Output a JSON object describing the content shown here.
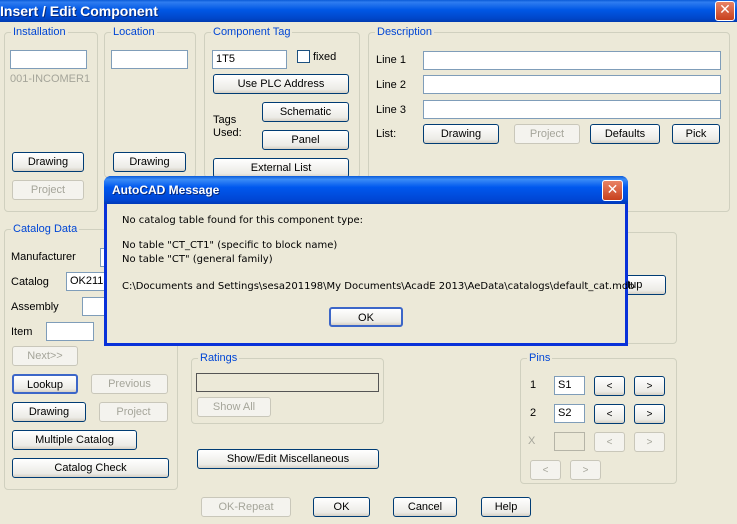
{
  "window": {
    "title": "Insert / Edit Component",
    "close_label": "✕"
  },
  "installation": {
    "legend": "Installation",
    "value": "",
    "sub_text": "001-INCOMER1",
    "drawing_label": "Drawing",
    "project_label": "Project"
  },
  "location": {
    "legend": "Location",
    "value": "",
    "drawing_label": "Drawing"
  },
  "component_tag": {
    "legend": "Component Tag",
    "value": "1T5",
    "fixed_label": "fixed",
    "use_plc_label": "Use PLC Address",
    "tags_used_label_1": "Tags",
    "tags_used_label_2": "Used:",
    "schematic_label": "Schematic",
    "panel_label": "Panel",
    "external_list_label": "External List"
  },
  "description": {
    "legend": "Description",
    "lines": [
      {
        "label": "Line 1",
        "value": ""
      },
      {
        "label": "Line 2",
        "value": ""
      },
      {
        "label": "Line 3",
        "value": ""
      }
    ],
    "list_label": "List:",
    "drawing_label": "Drawing",
    "project_label": "Project",
    "defaults_label": "Defaults",
    "pick_label": "Pick"
  },
  "catalog": {
    "legend": "Catalog Data",
    "manufacturer_label": "Manufacturer",
    "manufacturer_value": "",
    "catalog_label": "Catalog",
    "catalog_value": "OK2113",
    "assembly_label": "Assembly",
    "assembly_value": "",
    "item_label": "Item",
    "item_value": "",
    "next_label": "Next>>",
    "lookup_label": "Lookup",
    "previous_label": "Previous",
    "drawing_label": "Drawing",
    "project_label": "Project",
    "multiple_catalog_label": "Multiple Catalog",
    "catalog_check_label": "Catalog Check"
  },
  "right_partial": {
    "setup_label": "etup"
  },
  "ratings": {
    "legend": "Ratings",
    "value": "",
    "show_all_label": "Show All"
  },
  "misc": {
    "show_edit_misc_label": "Show/Edit Miscellaneous"
  },
  "pins": {
    "legend": "Pins",
    "rows": [
      {
        "label": "1",
        "value": "S1"
      },
      {
        "label": "2",
        "value": "S2"
      },
      {
        "label": "X",
        "value": ""
      }
    ],
    "prev_glyph": "<",
    "next_glyph": ">"
  },
  "footer": {
    "ok_repeat_label": "OK-Repeat",
    "ok_label": "OK",
    "cancel_label": "Cancel",
    "help_label": "Help"
  },
  "modal": {
    "title": "AutoCAD Message",
    "close_label": "✕",
    "line1": "No catalog table found for this component type:",
    "line2": "No table \"CT_CT1\" (specific to block name)",
    "line3": "No table \"CT\" (general family)",
    "line4": "C:\\Documents and Settings\\sesa201198\\My Documents\\AcadE 2013\\AeData\\catalogs\\default_cat.mdb",
    "ok_label": "OK"
  }
}
